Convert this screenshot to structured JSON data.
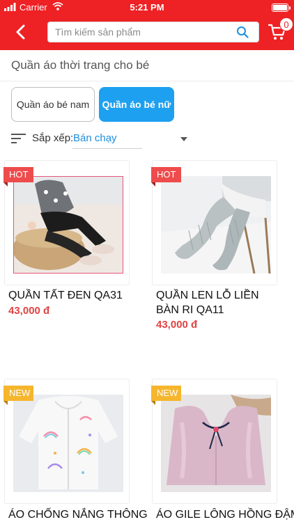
{
  "status_bar": {
    "carrier": "Carrier",
    "time": "5:21 PM"
  },
  "header": {
    "search_placeholder": "Tìm kiếm sản phẩm",
    "cart_count": "0",
    "brand_color": "#ee2124",
    "icons": [
      "back-chevron-icon",
      "search-icon",
      "cart-icon"
    ]
  },
  "page": {
    "title": "Quần áo thời trang cho bé"
  },
  "categories": [
    {
      "label": "Quần áo bé nam",
      "selected": false
    },
    {
      "label": "Quần áo bé nữ",
      "selected": true
    }
  ],
  "sort": {
    "label": "Sắp xếp:",
    "value": "Bán chạy"
  },
  "products": [
    {
      "badge": "HOT",
      "name": "QUẦN TẤT ĐEN QA31",
      "price": "43,000 đ"
    },
    {
      "badge": "HOT",
      "name": "QUẦN LEN LỖ LIỀN BÀN RI QA11",
      "price": "43,000 đ"
    },
    {
      "badge": "NEW",
      "name": "ÁO CHỐNG NẮNG THÔNG"
    },
    {
      "badge": "NEW",
      "name": "ÁO GILE LÔNG HỒNG ĐẬM"
    }
  ],
  "colors": {
    "accent_blue": "#1ea0f0",
    "price_red": "#e04343",
    "hot_badge": "#ee4c4c",
    "new_badge": "#f5b62e"
  }
}
